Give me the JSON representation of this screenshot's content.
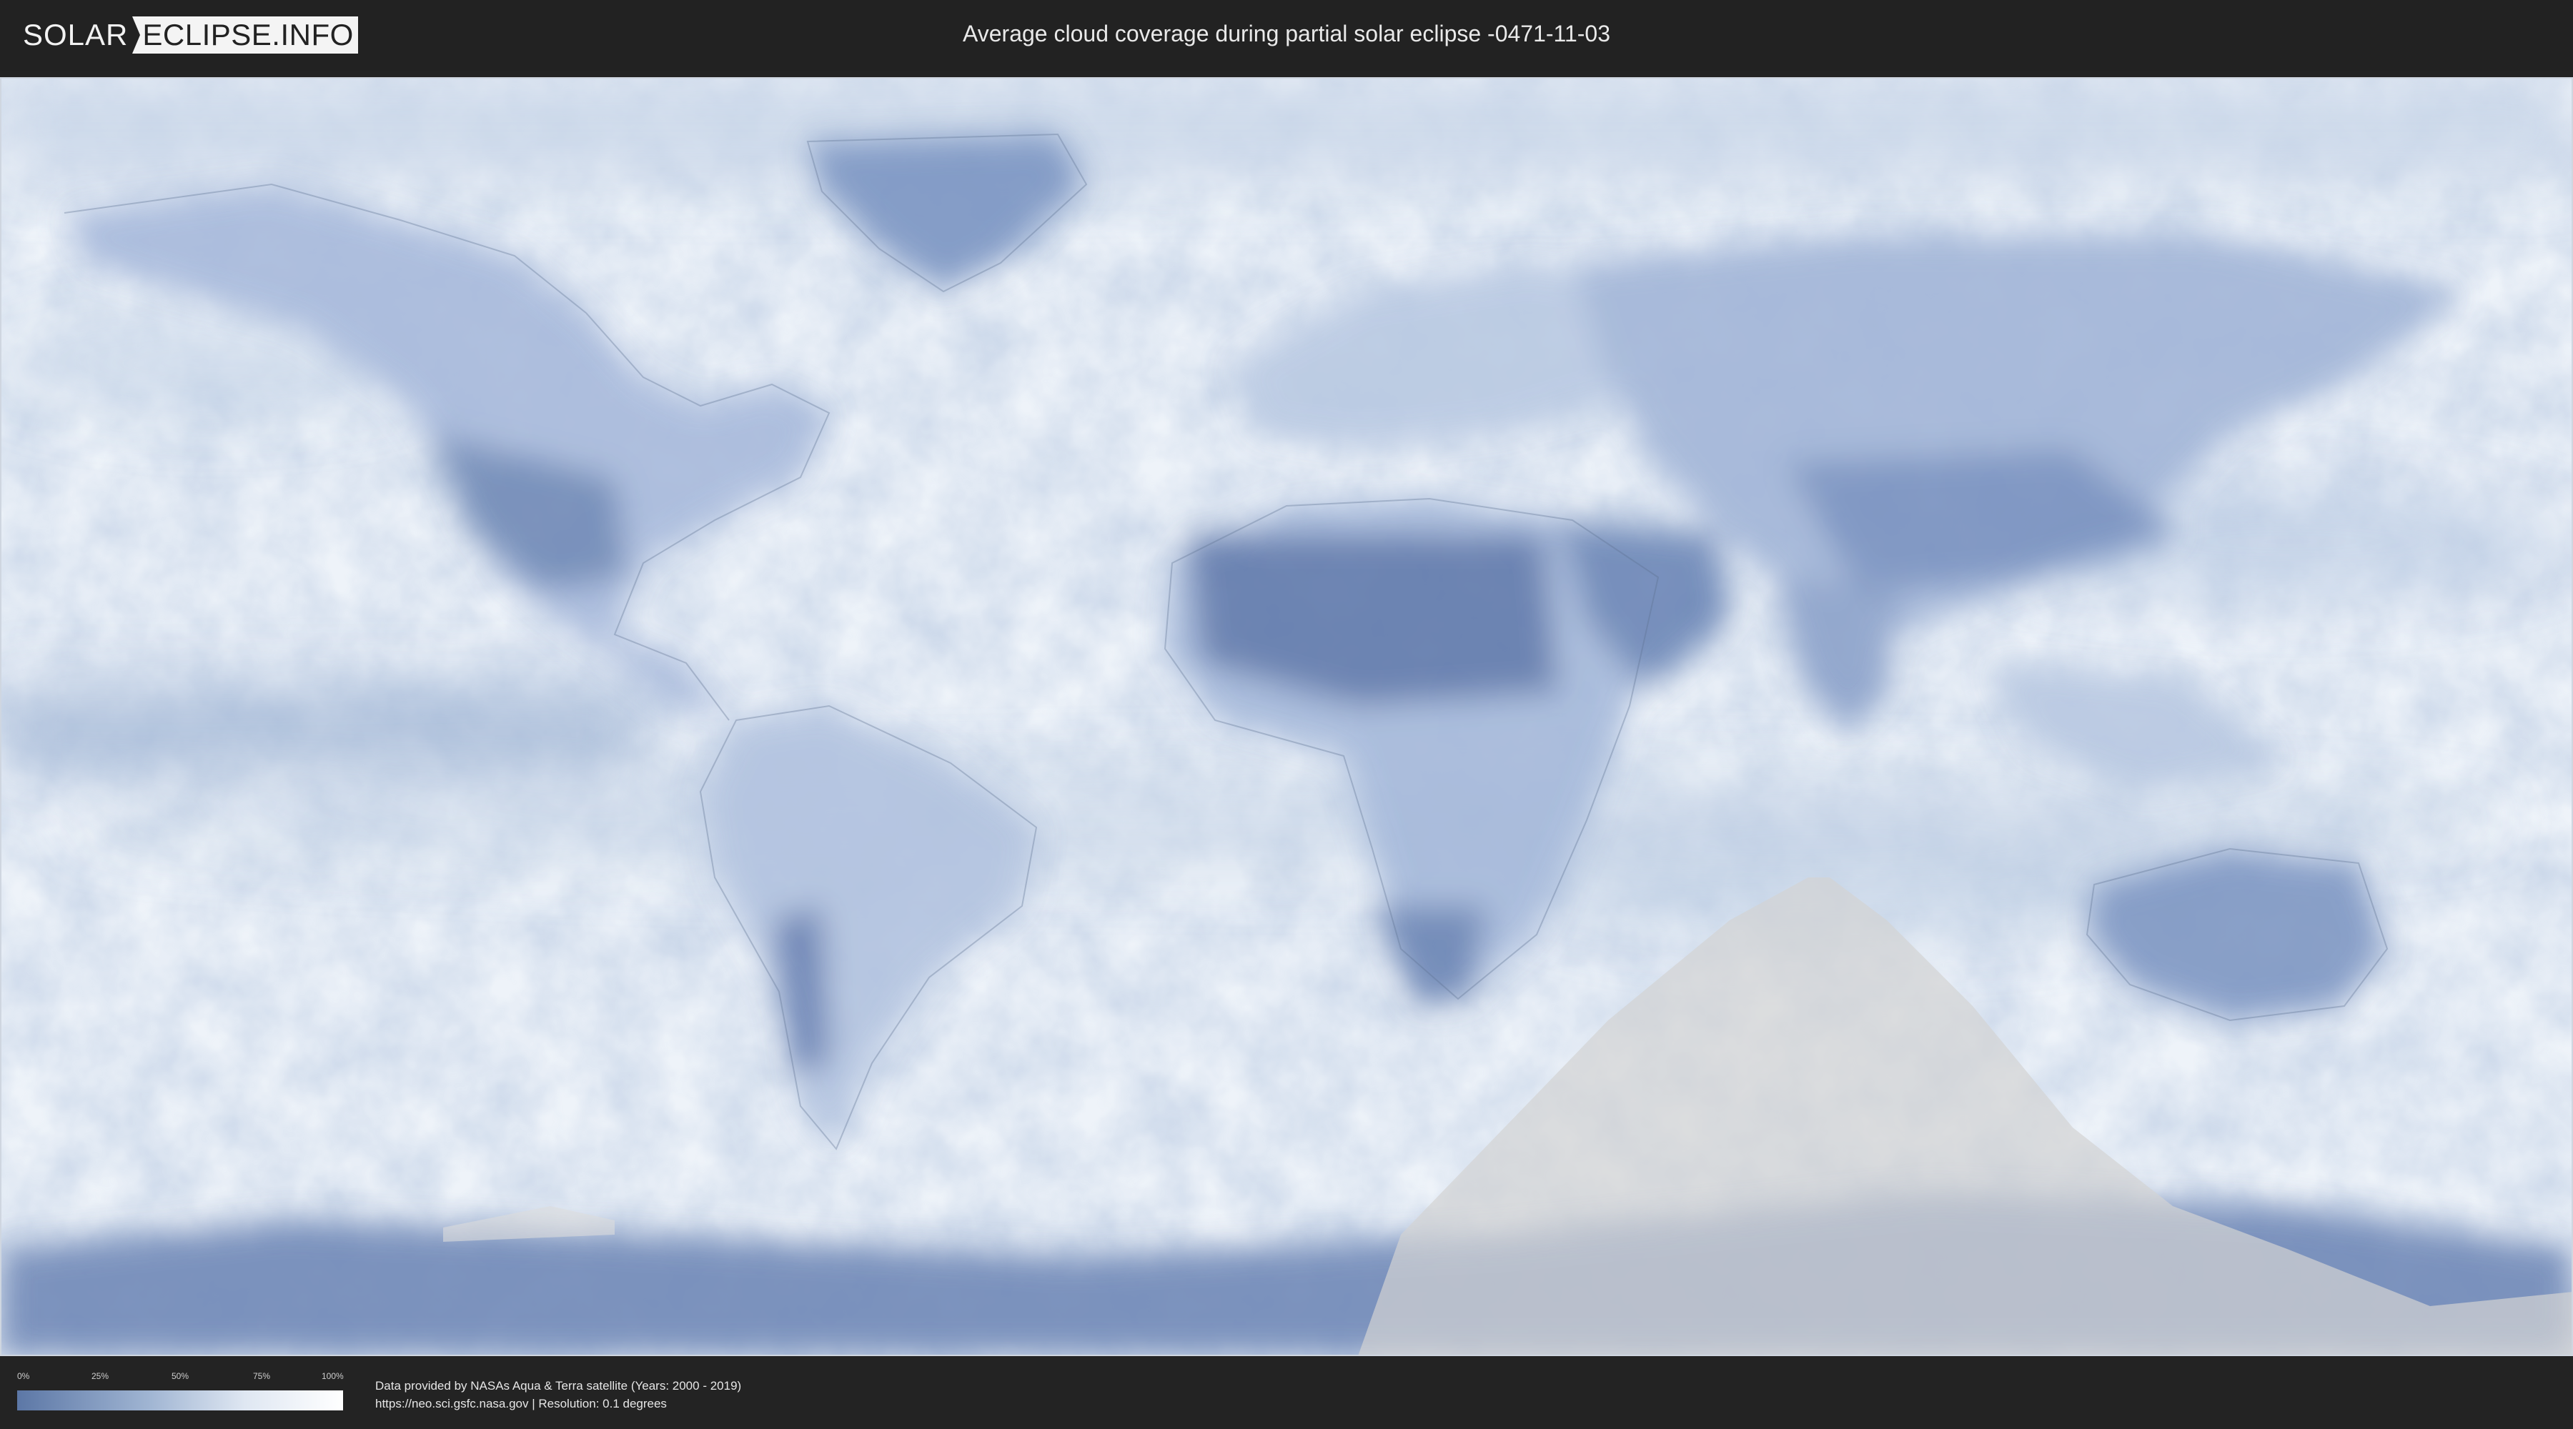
{
  "header": {
    "logo_primary": "SOLAR",
    "logo_secondary": "ECLIPSE.INFO",
    "title": "Average cloud coverage during partial solar eclipse -0471-11-03"
  },
  "legend": {
    "ticks": [
      "0%",
      "25%",
      "50%",
      "75%",
      "100%"
    ],
    "colors": {
      "low": "#5c77a6",
      "mid": "#a7bbd6",
      "high": "#ffffff"
    }
  },
  "footer": {
    "source_line": "Data provided by NASAs Aqua & Terra satellite (Years: 2000 - 2019)",
    "url_line": "https://neo.sci.gsfc.nasa.gov | Resolution: 0.1 degrees"
  },
  "map": {
    "type": "cloud-coverage-map",
    "projection": "equirectangular",
    "eclipse_type": "partial",
    "eclipse_date": "-0471-11-03",
    "colors": {
      "ocean_clear": "#f3f6fa",
      "cloud_dense": "#6f88b3",
      "land_clear": "#7d93bd",
      "eclipse_overlay": "#d3d3d3"
    }
  }
}
